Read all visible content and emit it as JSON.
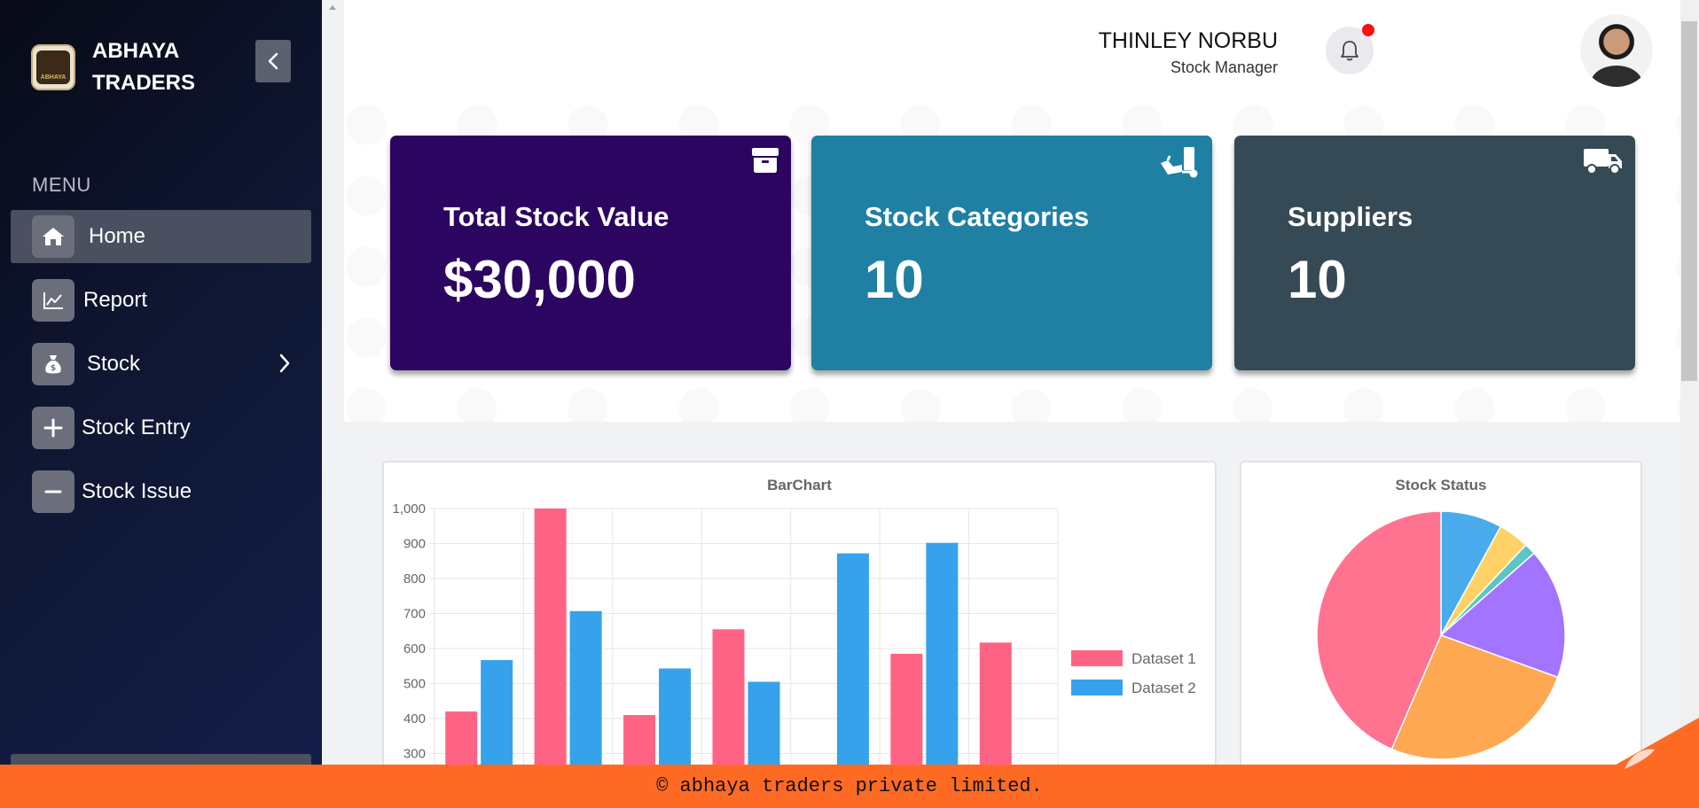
{
  "brand": {
    "name": "ABHAYA TRADERS",
    "logo_text": "ABHAYA"
  },
  "sidebar": {
    "menu_label": "MENU",
    "items": [
      {
        "label": "Home",
        "icon": "home-icon",
        "active": true
      },
      {
        "label": "Report",
        "icon": "chart-line-icon"
      },
      {
        "label": "Stock",
        "icon": "money-bag-icon",
        "has_submenu": true
      },
      {
        "label": "Stock Entry",
        "icon": "plus-icon"
      },
      {
        "label": "Stock Issue",
        "icon": "minus-icon"
      }
    ]
  },
  "header": {
    "user_name": "THINLEY NORBU",
    "user_role": "Stock Manager",
    "notification_badge": true
  },
  "cards": [
    {
      "title": "Total Stock Value",
      "value": "$30,000",
      "icon": "box-icon",
      "color": "#2b0560"
    },
    {
      "title": "Stock Categories",
      "value": "10",
      "icon": "dolly-icon",
      "color": "#1f80a3"
    },
    {
      "title": "Suppliers",
      "value": "10",
      "icon": "truck-icon",
      "color": "#354a55"
    }
  ],
  "chart_data": [
    {
      "type": "bar",
      "title": "BarChart",
      "categories": [
        "",
        "",
        "",
        "",
        "",
        "",
        ""
      ],
      "series": [
        {
          "name": "Dataset 1",
          "color": "#ff6384",
          "values": [
            420,
            1000,
            410,
            655,
            null,
            585,
            617
          ]
        },
        {
          "name": "Dataset 2",
          "color": "#36a2eb",
          "values": [
            567,
            707,
            543,
            505,
            872,
            902,
            null
          ]
        }
      ],
      "ylim": [
        200,
        1000
      ],
      "yticks": [
        "1,000",
        "900",
        "800",
        "700",
        "600",
        "500",
        "400",
        "300"
      ],
      "legend": "right",
      "grid": true
    },
    {
      "type": "pie",
      "title": "Stock Status",
      "slices": [
        {
          "value": 8,
          "color": "#36a2eb"
        },
        {
          "value": 4,
          "color": "#ffcd56"
        },
        {
          "value": 1.5,
          "color": "#4bc0c0"
        },
        {
          "value": 17,
          "color": "#9966ff"
        },
        {
          "value": 26,
          "color": "#ff9f40"
        },
        {
          "value": 43.5,
          "color": "#ff6384"
        }
      ]
    }
  ],
  "footer": {
    "text": "© abhaya traders private limited."
  }
}
